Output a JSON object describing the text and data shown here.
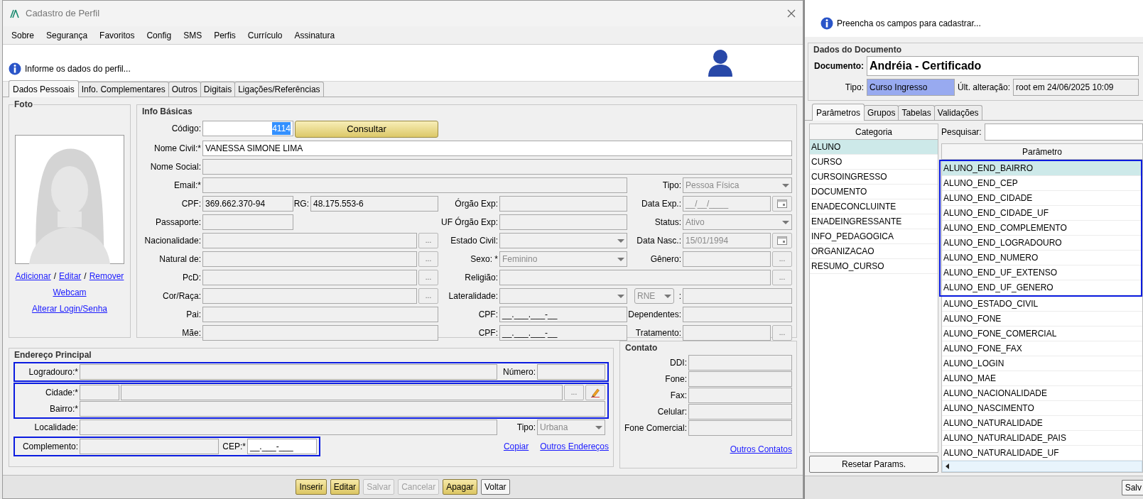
{
  "left_window": {
    "title": "Cadastro de Perfil",
    "menu": [
      "Sobre",
      "Segurança",
      "Favoritos",
      "Config",
      "SMS",
      "Perfis",
      "Currículo",
      "Assinatura"
    ],
    "header_message": "Informe os dados do perfil...",
    "tabs": [
      {
        "label": "Dados Pessoais",
        "selected": true
      },
      {
        "label": "Info. Complementares",
        "selected": false
      },
      {
        "label": "Outros",
        "selected": false
      },
      {
        "label": "Digitais",
        "selected": false
      },
      {
        "label": "Ligações/Referências",
        "selected": false
      }
    ],
    "foto": {
      "title": "Foto",
      "link_lines": [
        [
          {
            "kind": "link",
            "text": "Adicionar"
          },
          {
            "kind": "sep",
            "text": "/"
          },
          {
            "kind": "link",
            "text": "Editar"
          },
          {
            "kind": "sep",
            "text": "/"
          },
          {
            "kind": "link",
            "text": "Remover"
          }
        ],
        [
          {
            "kind": "link",
            "text": "Webcam"
          }
        ],
        [
          {
            "kind": "link",
            "text": "Alterar Login/Senha"
          }
        ]
      ]
    },
    "info_basicas": {
      "title": "Info Básicas",
      "rows": [
        {
          "items": [
            {
              "kind": "label",
              "text": "Código:"
            },
            {
              "kind": "field",
              "value": "4114",
              "disabled": false,
              "text_selected": true
            },
            {
              "kind": "button",
              "text": "Consultar"
            }
          ]
        },
        {
          "items": [
            {
              "kind": "label",
              "text": "Nome Civil:*"
            },
            {
              "kind": "field",
              "value": "VANESSA SIMONE LIMA",
              "disabled": false
            }
          ]
        },
        {
          "items": [
            {
              "kind": "label",
              "text": "Nome Social:"
            },
            {
              "kind": "field",
              "disabled": true
            }
          ]
        },
        {
          "items": [
            {
              "kind": "label",
              "text": "Email:*"
            },
            {
              "kind": "field",
              "disabled": true
            },
            {
              "kind": "label",
              "text": "Tipo:"
            },
            {
              "kind": "select",
              "value": "Pessoa Física",
              "disabled": true
            }
          ]
        },
        {
          "items": [
            {
              "kind": "label",
              "text": "CPF:"
            },
            {
              "kind": "field",
              "value": "369.662.370-94",
              "disabled": true
            },
            {
              "kind": "label",
              "text": "RG:"
            },
            {
              "kind": "field",
              "value": "48.175.553-6",
              "disabled": true
            },
            {
              "kind": "label",
              "text": "Órgão Exp:"
            },
            {
              "kind": "field",
              "disabled": true
            },
            {
              "kind": "label",
              "text": "Data Exp.:"
            },
            {
              "kind": "date",
              "value": "__/__/____",
              "disabled": true
            },
            {
              "kind": "calendar"
            }
          ]
        },
        {
          "items": [
            {
              "kind": "label",
              "text": "Passaporte:"
            },
            {
              "kind": "field",
              "disabled": true
            },
            {
              "kind": "label",
              "text": "UF Órgão Exp:"
            },
            {
              "kind": "field",
              "disabled": true
            },
            {
              "kind": "label",
              "text": "Status:"
            },
            {
              "kind": "select",
              "value": "Ativo",
              "disabled": true
            }
          ]
        },
        {
          "items": [
            {
              "kind": "label",
              "text": "Nacionalidade:"
            },
            {
              "kind": "field",
              "disabled": true
            },
            {
              "kind": "dots",
              "text": "..."
            },
            {
              "kind": "label",
              "text": "Estado Civil:"
            },
            {
              "kind": "select",
              "disabled": true
            },
            {
              "kind": "label",
              "text": "Data Nasc.:"
            },
            {
              "kind": "date",
              "value": "15/01/1994",
              "disabled": true
            },
            {
              "kind": "calendar"
            }
          ]
        },
        {
          "items": [
            {
              "kind": "label",
              "text": "Natural de:"
            },
            {
              "kind": "field",
              "disabled": true
            },
            {
              "kind": "dots",
              "text": "..."
            },
            {
              "kind": "label",
              "text": "Sexo: *"
            },
            {
              "kind": "select",
              "value": "Feminino",
              "disabled": true
            },
            {
              "kind": "label",
              "text": "Gênero:"
            },
            {
              "kind": "field",
              "disabled": true
            },
            {
              "kind": "dots",
              "text": "..."
            }
          ]
        },
        {
          "items": [
            {
              "kind": "label",
              "text": "PcD:"
            },
            {
              "kind": "field",
              "disabled": true
            },
            {
              "kind": "dots",
              "text": "..."
            },
            {
              "kind": "label",
              "text": "Religião:"
            },
            {
              "kind": "field",
              "disabled": true
            },
            {
              "kind": "dots",
              "text": "..."
            }
          ]
        },
        {
          "items": [
            {
              "kind": "label",
              "text": "Cor/Raça:"
            },
            {
              "kind": "field",
              "disabled": true
            },
            {
              "kind": "dots",
              "text": "..."
            },
            {
              "kind": "label",
              "text": "Lateralidade:"
            },
            {
              "kind": "select",
              "disabled": true
            },
            {
              "kind": "smallselect",
              "value": "RNE",
              "disabled": true
            },
            {
              "kind": "colon",
              "text": ":"
            },
            {
              "kind": "field",
              "disabled": true
            }
          ]
        },
        {
          "items": [
            {
              "kind": "label",
              "text": "Pai:"
            },
            {
              "kind": "field",
              "disabled": true
            },
            {
              "kind": "label",
              "text": "CPF:"
            },
            {
              "kind": "field",
              "value": "__.___.___-__",
              "disabled": true
            },
            {
              "kind": "label",
              "text": "Dependentes:"
            },
            {
              "kind": "field",
              "disabled": true
            }
          ]
        },
        {
          "items": [
            {
              "kind": "label",
              "text": "Mãe:"
            },
            {
              "kind": "field",
              "disabled": true
            },
            {
              "kind": "label",
              "text": "CPF:"
            },
            {
              "kind": "field",
              "value": "__.___.___-__",
              "disabled": true
            },
            {
              "kind": "label",
              "text": "Tratamento:"
            },
            {
              "kind": "field",
              "disabled": true
            },
            {
              "kind": "dots",
              "text": "..."
            }
          ]
        }
      ]
    },
    "endereco": {
      "title": "Endereço Principal",
      "groups": [
        {
          "highlighted": true,
          "rows": [
            {
              "items": [
                {
                  "kind": "label",
                  "text": "Logradouro:*"
                },
                {
                  "kind": "field",
                  "disabled": true
                },
                {
                  "kind": "label",
                  "text": "Número:"
                },
                {
                  "kind": "field",
                  "disabled": true
                }
              ]
            }
          ]
        },
        {
          "highlighted": true,
          "rows": [
            {
              "items": [
                {
                  "kind": "label",
                  "text": "Cidade:*"
                },
                {
                  "kind": "field",
                  "disabled": true
                },
                {
                  "kind": "field",
                  "disabled": true
                },
                {
                  "kind": "dots",
                  "text": "..."
                },
                {
                  "kind": "pencil"
                }
              ]
            },
            {
              "items": [
                {
                  "kind": "label",
                  "text": "Bairro:*"
                },
                {
                  "kind": "field",
                  "disabled": true
                }
              ]
            }
          ]
        },
        {
          "highlighted": false,
          "rows": [
            {
              "items": [
                {
                  "kind": "label",
                  "text": "Localidade:"
                },
                {
                  "kind": "field",
                  "disabled": true
                },
                {
                  "kind": "label",
                  "text": "Tipo:"
                },
                {
                  "kind": "select",
                  "value": "Urbana",
                  "disabled": true
                }
              ]
            }
          ]
        },
        {
          "highlighted": true,
          "rows": [
            {
              "items": [
                {
                  "kind": "label",
                  "text": "Complemento:"
                },
                {
                  "kind": "field",
                  "disabled": true
                },
                {
                  "kind": "label",
                  "text": "CEP:*"
                },
                {
                  "kind": "field",
                  "value": "__.___-___",
                  "disabled": false
                }
              ]
            }
          ]
        }
      ],
      "links": [
        "Copiar",
        "Outros Endereços"
      ]
    },
    "contato": {
      "title": "Contato",
      "rows": [
        {
          "label": "DDI:"
        },
        {
          "label": "Fone:"
        },
        {
          "label": "Fax:"
        },
        {
          "label": "Celular:"
        },
        {
          "label": "Fone Comercial:"
        }
      ],
      "link": "Outros Contatos"
    },
    "buttons": [
      {
        "label": "Inserir",
        "disabled": false
      },
      {
        "label": "Editar",
        "disabled": false
      },
      {
        "label": "Salvar",
        "disabled": true
      },
      {
        "label": "Cancelar",
        "disabled": true
      },
      {
        "label": "Apagar",
        "disabled": false
      },
      {
        "label": "Voltar",
        "disabled": false,
        "kind": "plain"
      }
    ]
  },
  "right_window": {
    "message": "Preencha os campos para cadastrar...",
    "document_group": {
      "title": "Dados do Documento",
      "document_label": "Documento:",
      "document_value": "Andréia - Certificado",
      "tipo_label": "Tipo:",
      "tipo_value": "Curso Ingresso",
      "alteracao_label": "Últ. alteração:",
      "alteracao_value": "root em 24/06/2025 10:09"
    },
    "tabs": [
      {
        "label": "Parâmetros",
        "selected": true
      },
      {
        "label": "Grupos",
        "selected": false
      },
      {
        "label": "Tabelas",
        "selected": false
      },
      {
        "label": "Validações",
        "selected": false
      }
    ],
    "category_header": "Categoria",
    "categories": [
      {
        "label": "ALUNO",
        "selected": true
      },
      {
        "label": "CURSO",
        "selected": false
      },
      {
        "label": "CURSOINGRESSO",
        "selected": false
      },
      {
        "label": "DOCUMENTO",
        "selected": false
      },
      {
        "label": "ENADECONCLUINTE",
        "selected": false
      },
      {
        "label": "ENADEINGRESSANTE",
        "selected": false
      },
      {
        "label": "INFO_PEDAGOGICA",
        "selected": false
      },
      {
        "label": "ORGANIZACAO",
        "selected": false
      },
      {
        "label": "RESUMO_CURSO",
        "selected": false
      }
    ],
    "reset_button": "Resetar Params.",
    "search_label": "Pesquisar:",
    "param_header": "Parâmetro",
    "parameter_groups": [
      {
        "highlighted": true,
        "rows": [
          {
            "name": "ALUNO_END_BAIRRO",
            "selected": true
          },
          {
            "name": "ALUNO_END_CEP",
            "selected": false
          },
          {
            "name": "ALUNO_END_CIDADE",
            "selected": false
          },
          {
            "name": "ALUNO_END_CIDADE_UF",
            "selected": false
          },
          {
            "name": "ALUNO_END_COMPLEMENTO",
            "selected": false
          },
          {
            "name": "ALUNO_END_LOGRADOURO",
            "selected": false
          },
          {
            "name": "ALUNO_END_NUMERO",
            "selected": false
          },
          {
            "name": "ALUNO_END_UF_EXTENSO",
            "selected": false
          },
          {
            "name": "ALUNO_END_UF_GENERO",
            "selected": false
          }
        ]
      },
      {
        "highlighted": false,
        "rows": [
          {
            "name": "ALUNO_ESTADO_CIVIL",
            "selected": false
          },
          {
            "name": "ALUNO_FONE",
            "selected": false
          },
          {
            "name": "ALUNO_FONE_COMERCIAL",
            "selected": false
          },
          {
            "name": "ALUNO_FONE_FAX",
            "selected": false
          },
          {
            "name": "ALUNO_LOGIN",
            "selected": false
          },
          {
            "name": "ALUNO_MAE",
            "selected": false
          },
          {
            "name": "ALUNO_NACIONALIDADE",
            "selected": false
          },
          {
            "name": "ALUNO_NASCIMENTO",
            "selected": false
          },
          {
            "name": "ALUNO_NATURALIDADE",
            "selected": false
          },
          {
            "name": "ALUNO_NATURALIDADE_PAIS",
            "selected": false
          },
          {
            "name": "ALUNO_NATURALIDADE_UF",
            "selected": false
          }
        ]
      }
    ],
    "bottom_button": "Salv"
  }
}
